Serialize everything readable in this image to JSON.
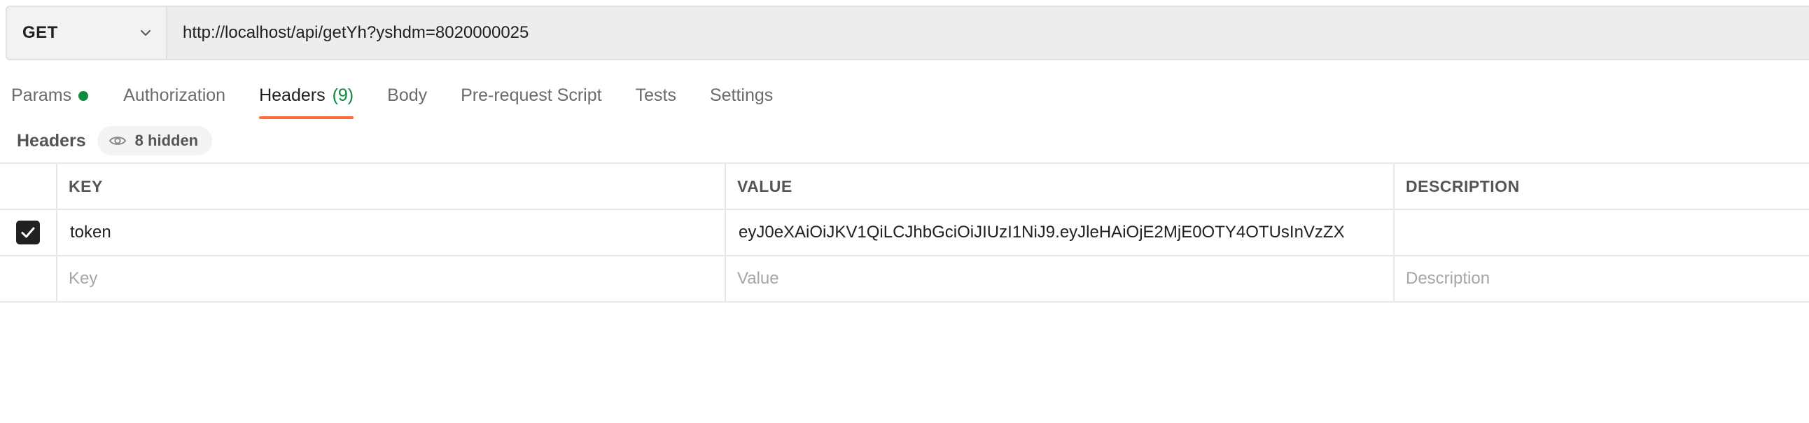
{
  "request": {
    "method": "GET",
    "url": "http://localhost/api/getYh?yshdm=8020000025",
    "method_icon": "chevron-down-icon"
  },
  "tabs": [
    {
      "label": "Params",
      "indicator_color": "#0e8a3f"
    },
    {
      "label": "Authorization"
    },
    {
      "label": "Headers",
      "count": "(9)",
      "active": true
    },
    {
      "label": "Body"
    },
    {
      "label": "Pre-request Script"
    },
    {
      "label": "Tests"
    },
    {
      "label": "Settings"
    }
  ],
  "headers_section": {
    "title": "Headers",
    "hidden_label": "8 hidden",
    "hidden_icon": "eye-icon"
  },
  "table": {
    "columns": [
      "KEY",
      "VALUE",
      "DESCRIPTION"
    ],
    "rows": [
      {
        "checked": true,
        "key": "token",
        "value": "eyJ0eXAiOiJKV1QiLCJhbGciOiJIUzI1NiJ9.eyJleHAiOjE2MjE0OTY4OTUsInVzZX",
        "description": ""
      }
    ],
    "new_row": {
      "key_placeholder": "Key",
      "value_placeholder": "Value",
      "description_placeholder": "Description"
    }
  },
  "colors": {
    "accent": "#ff6c37",
    "success": "#0e8a3f",
    "checkbox": "#212121"
  }
}
